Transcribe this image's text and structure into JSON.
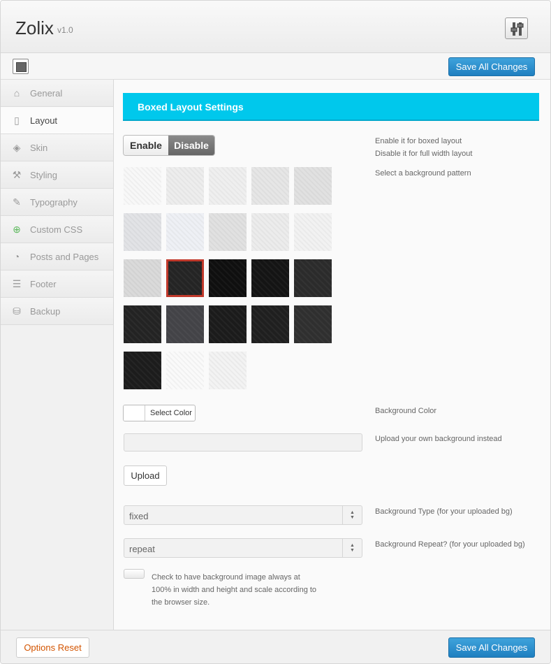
{
  "header": {
    "brand": "Zolix",
    "version": "v1.0",
    "settings_icon": "sliders-icon"
  },
  "toolbar": {
    "save_label": "Save All Changes",
    "layout_icon": "layout-icon"
  },
  "sidebar": {
    "items": [
      {
        "label": "General",
        "icon": "home-icon"
      },
      {
        "label": "Layout",
        "icon": "page-icon",
        "active": true
      },
      {
        "label": "Skin",
        "icon": "paint-bucket-icon"
      },
      {
        "label": "Styling",
        "icon": "wrench-icon"
      },
      {
        "label": "Typography",
        "icon": "pencil-icon"
      },
      {
        "label": "Custom CSS",
        "icon": "add-circle-icon"
      },
      {
        "label": "Posts and Pages",
        "icon": "pie-icon"
      },
      {
        "label": "Footer",
        "icon": "footer-icon"
      },
      {
        "label": "Backup",
        "icon": "drive-icon"
      }
    ]
  },
  "section": {
    "title": "Boxed Layout Settings",
    "toggle": {
      "enable": "Enable",
      "disable": "Disable",
      "selected": "Disable"
    },
    "toggle_desc": [
      "Enable it for boxed layout",
      "Disable it for full width layout"
    ],
    "pattern_desc": "Select a background pattern",
    "patterns": [
      [
        "#f8f8f8",
        "#ededed",
        "#efefef",
        "#e6e6e6",
        "#e1e1e1"
      ],
      [
        "#e2e3e6",
        "#eef0f5",
        "#e1e1e1",
        "#ececec",
        "#f2f2f2"
      ],
      [
        "#dadada",
        "#242424",
        "#0f0f0f",
        "#141414",
        "#2b2b2b"
      ],
      [
        "#232323",
        "#434347",
        "#1b1b1b",
        "#1f1f1f",
        "#2f2f2f"
      ],
      [
        "#1c1c1c",
        "#fafafa",
        "#f3f3f3"
      ]
    ],
    "selected_pattern": [
      2,
      1
    ],
    "color_button": "Select Color",
    "color_desc": "Background Color",
    "upload_value": "",
    "upload_desc": "Upload your own background instead",
    "upload_button": "Upload",
    "bg_type": {
      "value": "fixed",
      "desc": "Background Type (for your uploaded bg)"
    },
    "bg_repeat": {
      "value": "repeat",
      "desc": "Background Repeat? (for your uploaded bg)"
    },
    "fullsize_checked": false,
    "fullsize_desc": "Check to have background image always at 100% in width and height and scale according to the browser size."
  },
  "footer": {
    "reset_label": "Options Reset",
    "save_label": "Save All Changes"
  }
}
